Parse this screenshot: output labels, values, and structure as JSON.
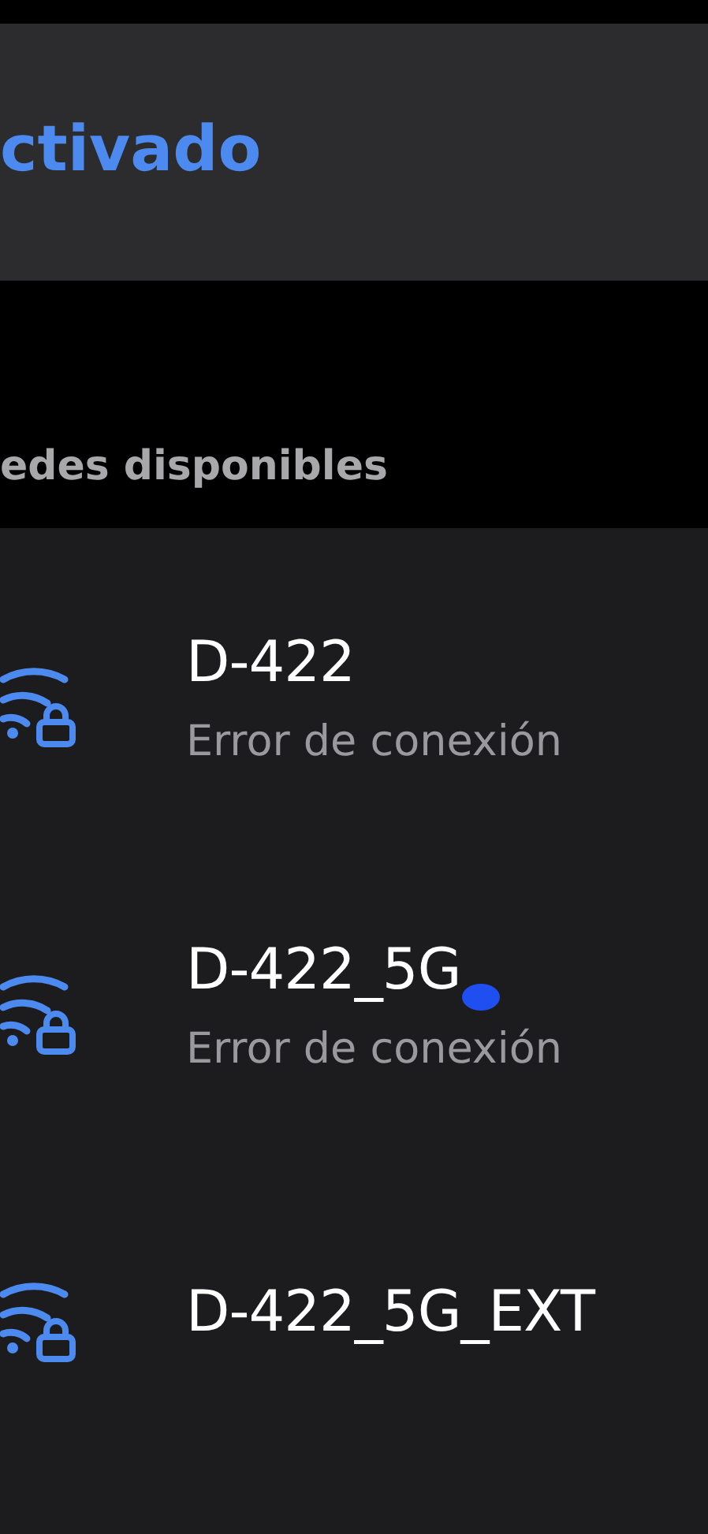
{
  "wifi_toggle": {
    "label": "ctivado"
  },
  "section_title": "edes disponibles",
  "networks": [
    {
      "name": "D-422",
      "status": "Error de conexión",
      "secured": true,
      "touched": false
    },
    {
      "name": "D-422_5G",
      "status": "Error de conexión",
      "secured": true,
      "touched": true
    },
    {
      "name": "D-422_5G_EXT",
      "secured": true,
      "touched": false
    }
  ]
}
